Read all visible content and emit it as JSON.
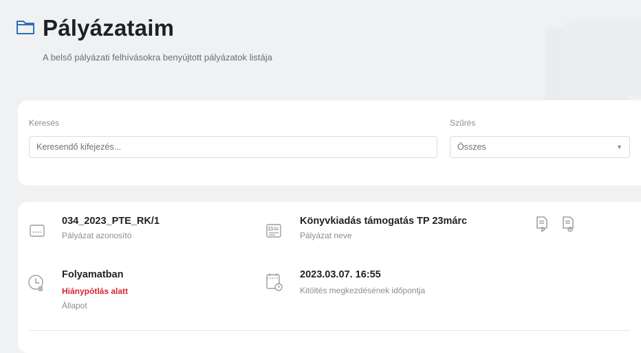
{
  "header": {
    "title": "Pályázataim",
    "subtitle": "A belső pályázati felhívásokra benyújtott pályázatok listája"
  },
  "search": {
    "label": "Keresés",
    "placeholder": "Keresendő kifejezés...",
    "filter_label": "Szűrés",
    "filter_value": "Összes"
  },
  "result": {
    "id_value": "034_2023_PTE_RK/1",
    "id_caption": "Pályázat azonosító",
    "name_value": "Könyvkiadás támogatás TP 23márc",
    "name_caption": "Pályázat neve",
    "status_value": "Folyamatban",
    "status_sub": "Hiánypótlás alatt",
    "status_caption": "Állapot",
    "date_value": "2023.03.07. 16:55",
    "date_caption": "Kitöltés megkezdésének időpontja"
  },
  "icons": {
    "title": "folder-icon",
    "id": "id-card-icon",
    "name": "form-icon",
    "status": "clock-icon",
    "date": "calendar-icon",
    "action1": "document-edit-icon",
    "action2": "document-view-icon"
  },
  "colors": {
    "accent": "#2d6fb8",
    "status_red": "#d7262f",
    "icon_gray": "#8a8c92"
  }
}
